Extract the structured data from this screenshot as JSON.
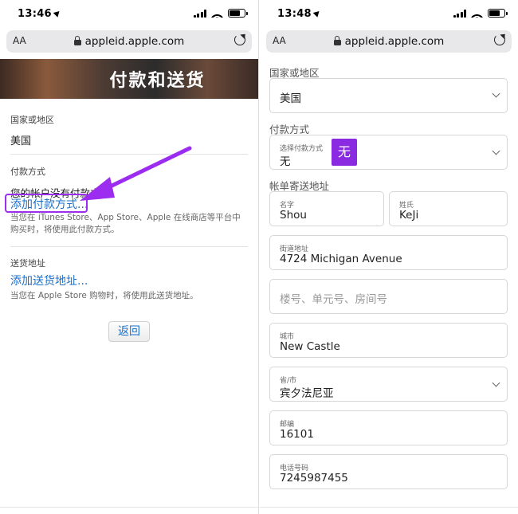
{
  "left": {
    "time": "13:46",
    "url": "appleid.apple.com",
    "aa": "AA",
    "banner_title": "付款和送货",
    "country": {
      "label": "国家或地区",
      "value": "美国"
    },
    "payment": {
      "label": "付款方式",
      "note": "您的帐户没有付款方式。",
      "link": "添加付款方式...",
      "hint": "当您在 iTunes Store、App Store、Apple 在线商店等平台中购买时，将使用此付款方式。"
    },
    "shipping": {
      "label": "送货地址",
      "link": "添加送货地址...",
      "hint": "当您在 Apple Store 购物时，将使用此送货地址。"
    },
    "back_label": "返回"
  },
  "right": {
    "time": "13:48",
    "url": "appleid.apple.com",
    "aa": "AA",
    "country_section": "国家或地区",
    "country_value": "美国",
    "payment_section": "付款方式",
    "payment_field_label": "选择付款方式",
    "payment_field_value": "无",
    "badge": "无",
    "billing_section": "帐单寄送地址",
    "first_name": {
      "label": "名字",
      "value": "Shou"
    },
    "last_name": {
      "label": "姓氏",
      "value": "KeJi"
    },
    "street": {
      "label": "街道地址",
      "value": "4724 Michigan Avenue"
    },
    "apt_placeholder": "楼号、单元号、房间号",
    "city": {
      "label": "城市",
      "value": "New Castle"
    },
    "state": {
      "label": "省/市",
      "value": "宾夕法尼亚"
    },
    "zip": {
      "label": "邮编",
      "value": "16101"
    },
    "phone": {
      "label": "电话号码",
      "value": "7245987455"
    }
  },
  "colors": {
    "link": "#1b6fc8",
    "highlight": "#9b2cf0",
    "badge": "#8a2be2"
  }
}
